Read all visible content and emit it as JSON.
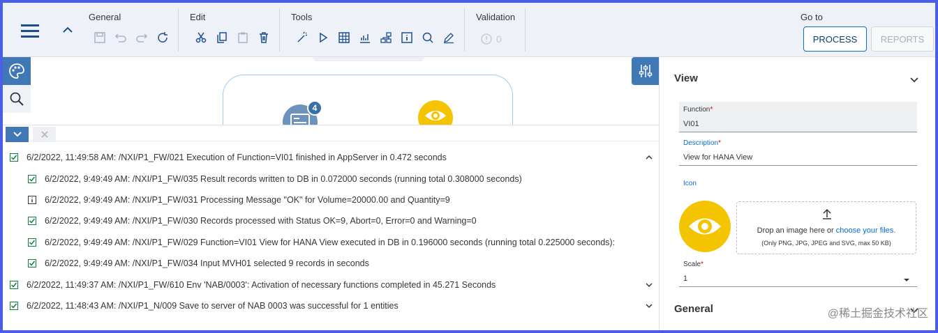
{
  "toolbar": {
    "groups": {
      "general": "General",
      "edit": "Edit",
      "tools": "Tools",
      "validation": "Validation",
      "goto": "Go to"
    },
    "validation_count": "0",
    "process_label": "PROCESS",
    "reports_label": "REPORTS"
  },
  "canvas": {
    "node_badge": "4"
  },
  "log": {
    "entries": [
      {
        "level": 0,
        "status": "success",
        "text": "6/2/2022, 11:49:58 AM: /NXI/P1_FW/021 Execution of Function=VI01 finished in AppServer in 0.472 seconds",
        "expanded": true
      },
      {
        "level": 1,
        "status": "success",
        "text": "6/2/2022, 9:49:49 AM: /NXI/P1_FW/035 Result records written to DB in 0.072000 seconds (running total 0.308000 seconds)"
      },
      {
        "level": 1,
        "status": "info",
        "text": "6/2/2022, 9:49:49 AM: /NXI/P1_FW/031 Processing Message \"OK\" for Volume=20000.00 and Quantity=9"
      },
      {
        "level": 1,
        "status": "success",
        "text": "6/2/2022, 9:49:49 AM: /NXI/P1_FW/030 Records processed with Status OK=9, Abort=0, Error=0 and Warning=0"
      },
      {
        "level": 1,
        "status": "success",
        "text": "6/2/2022, 9:49:49 AM: /NXI/P1_FW/029 Function=VI01 View for HANA View executed in DB in 0.196000 seconds (running total 0.225000 seconds):"
      },
      {
        "level": 1,
        "status": "success",
        "text": "6/2/2022, 9:49:49 AM: /NXI/P1_FW/034 Input MVH01 selected 9 records in seconds"
      },
      {
        "level": 0,
        "status": "success",
        "text": "6/2/2022, 11:49:37 AM: /NXI/P1_FW/610 Env 'NAB/0003': Activation of necessary functions completed in 45.271 Seconds",
        "expanded": false
      },
      {
        "level": 0,
        "status": "success",
        "text": "6/2/2022, 11:48:43 AM: /NXI/P1_N/009 Save to server of NAB 0003 was successful for 1 entities",
        "expanded": false
      }
    ]
  },
  "panel": {
    "view_title": "View",
    "function_label": "Function",
    "function_value": "VI01",
    "description_label": "Description",
    "description_value": "View for HANA View",
    "icon_label": "Icon",
    "drop_text": "Drop an image here or",
    "drop_link": "choose your files.",
    "drop_hint": "(Only PNG, JPG, JPEG and SVG, max 50 KB)",
    "scale_label": "Scale",
    "scale_value": "1",
    "general_title": "General"
  },
  "watermark": "@稀土掘金技术社区",
  "colors": {
    "accent": "#0a6ed1",
    "sidebar_blue": "#3f78b5",
    "eye_yellow": "#f5c400",
    "success": "#107e3e"
  }
}
